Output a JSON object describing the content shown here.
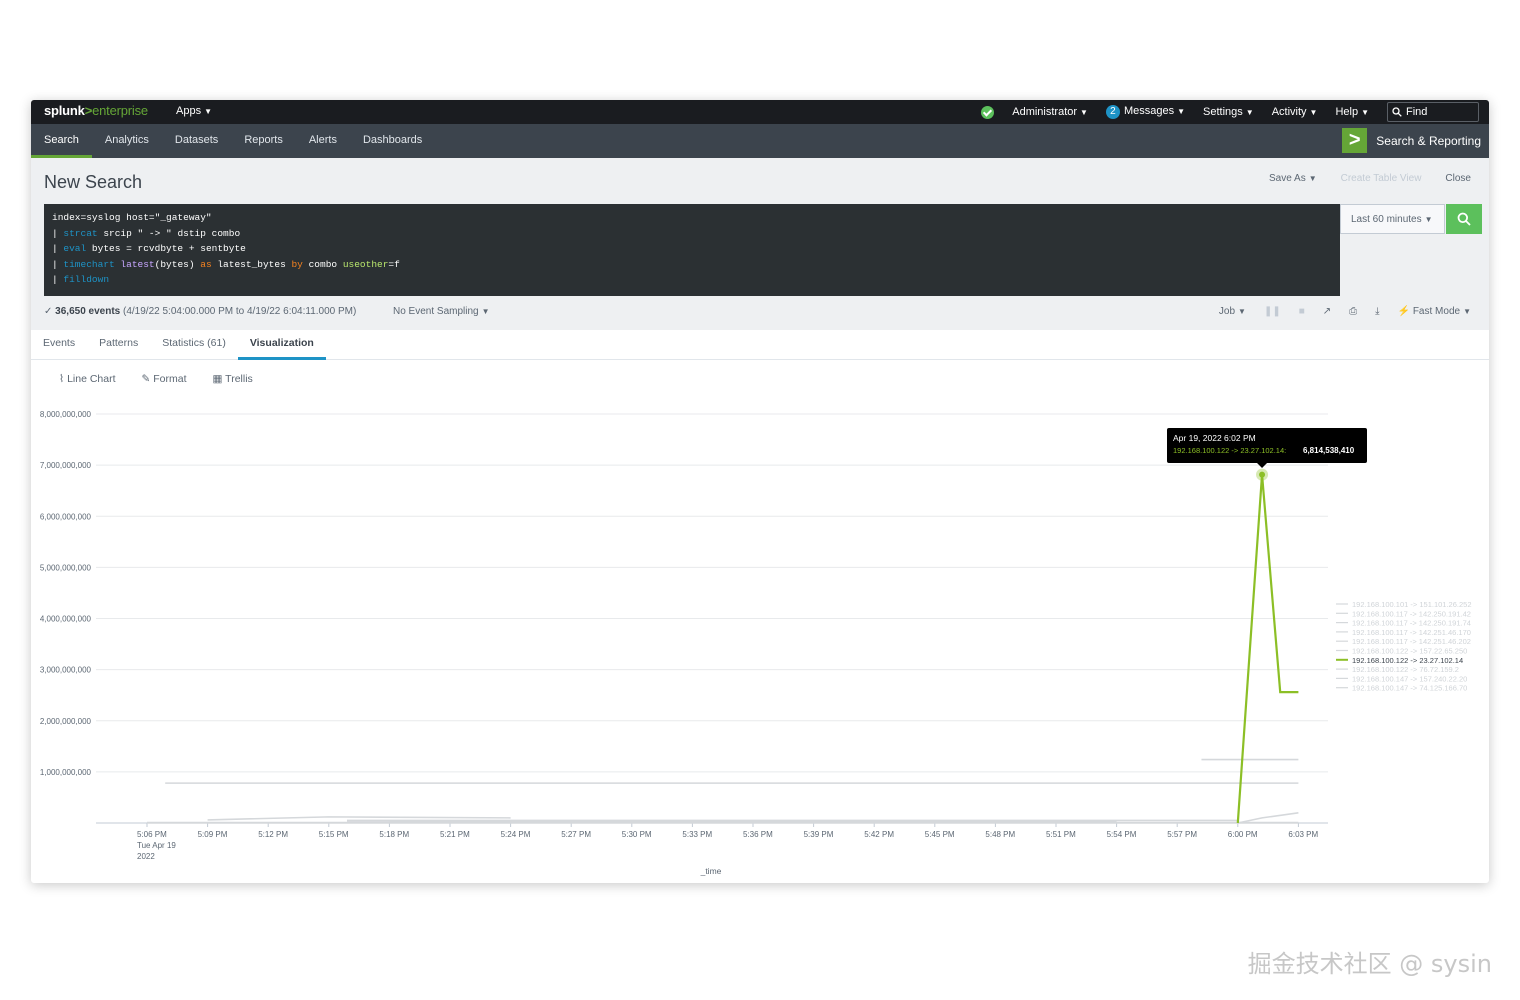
{
  "topbar": {
    "logo_splunk": "splunk",
    "logo_gt": ">",
    "logo_enterprise": "enterprise",
    "apps": "Apps",
    "admin": "Administrator",
    "messages_count": "2",
    "messages": "Messages",
    "settings": "Settings",
    "activity": "Activity",
    "help": "Help",
    "find": "Find"
  },
  "nav": {
    "tabs": [
      "Search",
      "Analytics",
      "Datasets",
      "Reports",
      "Alerts",
      "Dashboards"
    ],
    "app_title": "Search & Reporting"
  },
  "page": {
    "title": "New Search",
    "save_as": "Save As",
    "create_table_view": "Create Table View",
    "close": "Close"
  },
  "query": {
    "line1": "index=syslog host=\"_gateway\"",
    "l2_pipe": "| ",
    "l2_cmd": "strcat",
    "l2_rest": " srcip \" -> \" dstip combo",
    "l3_pipe": "| ",
    "l3_cmd": "eval",
    "l3_rest": " bytes = rcvdbyte + sentbyte",
    "l4_pipe": "| ",
    "l4_cmd": "timechart",
    "l4_fn": "latest",
    "l4_a": "(bytes) ",
    "l4_as": "as",
    "l4_b": " latest_bytes ",
    "l4_by": "by",
    "l4_c": " combo ",
    "l4_arg": "useother",
    "l4_d": "=f",
    "l5_pipe": "| ",
    "l5_cmd": "filldown"
  },
  "time_picker": "Last 60 minutes",
  "status": {
    "check": "✓",
    "events": "36,650 events",
    "range": "(4/19/22 5:04:00.000 PM to 4/19/22 6:04:11.000 PM)",
    "sampling": "No Event Sampling",
    "job": "Job",
    "mode": "Fast Mode"
  },
  "tabs": [
    "Events",
    "Patterns",
    "Statistics (61)",
    "Visualization"
  ],
  "viz": {
    "line_chart": "Line Chart",
    "format": "Format",
    "trellis": "Trellis"
  },
  "chart_data": {
    "type": "line",
    "x": [
      "5:06 PM",
      "5:09 PM",
      "5:12 PM",
      "5:15 PM",
      "5:18 PM",
      "5:21 PM",
      "5:24 PM",
      "5:27 PM",
      "5:30 PM",
      "5:33 PM",
      "5:36 PM",
      "5:39 PM",
      "5:42 PM",
      "5:45 PM",
      "5:48 PM",
      "5:51 PM",
      "5:54 PM",
      "5:57 PM",
      "6:00 PM",
      "6:03 PM"
    ],
    "x_first_sub": [
      "Tue Apr 19",
      "2022"
    ],
    "xlabel": "_time",
    "ylim": [
      0,
      8000000000
    ],
    "yticks": [
      "8,000,000,000",
      "7,000,000,000",
      "6,000,000,000",
      "5,000,000,000",
      "4,000,000,000",
      "3,000,000,000",
      "2,000,000,000",
      "1,000,000,000"
    ],
    "ytick_values": [
      8000000000,
      7000000000,
      6000000000,
      5000000000,
      4000000000,
      3000000000,
      2000000000,
      1000000000
    ],
    "series": [
      {
        "name": "192.168.100.101 -> 151.101.26.252",
        "color": "#d5d8db",
        "points": [
          [
            1.0,
            60000000
          ],
          [
            3.0,
            120000000
          ],
          [
            6.0,
            100000000
          ]
        ]
      },
      {
        "name": "192.168.100.117 -> 142.250.191.42",
        "color": "#d5d8db",
        "points": [
          [
            0.0,
            0
          ],
          [
            19.0,
            0
          ]
        ]
      },
      {
        "name": "192.168.100.117 -> 142.250.191.74",
        "color": "#d5d8db",
        "points": [
          [
            3.3,
            20000000
          ],
          [
            14.4,
            20000000
          ]
        ]
      },
      {
        "name": "192.168.100.117 -> 142.251.46.170",
        "color": "#d5d8db",
        "points": [
          [
            0.3,
            780000000
          ],
          [
            19.0,
            780000000
          ]
        ]
      },
      {
        "name": "192.168.100.117 -> 142.251.46.202",
        "color": "#d5d8db",
        "points": [
          [
            3.3,
            50000000
          ],
          [
            18.0,
            50000000
          ]
        ]
      },
      {
        "name": "192.168.100.122 -> 157.22.65.250",
        "color": "#d5d8db",
        "points": [
          [
            18.0,
            0
          ],
          [
            18.4,
            100000000
          ],
          [
            19.0,
            200000000
          ]
        ]
      },
      {
        "name": "192.168.100.122 -> 23.27.102.14",
        "color": "#8cbf26",
        "points": [
          [
            18.0,
            0
          ],
          [
            18.4,
            6814538410
          ],
          [
            18.7,
            2560000000
          ],
          [
            19.0,
            2560000000
          ]
        ]
      },
      {
        "name": "192.168.100.122 -> 76.72.159.2",
        "color": "#d5d8db",
        "points": [
          [
            17.4,
            1240000000
          ],
          [
            19.0,
            1240000000
          ]
        ]
      },
      {
        "name": "192.168.100.147 -> 157.240.22.20",
        "color": "#d5d8db",
        "points": [
          [
            0.0,
            10000000
          ],
          [
            19.0,
            10000000
          ]
        ]
      },
      {
        "name": "192.168.100.147 -> 74.125.166.70",
        "color": "#d5d8db",
        "points": [
          [
            4.0,
            30000000
          ],
          [
            16.0,
            30000000
          ]
        ]
      }
    ],
    "highlight_series": 6,
    "tooltip": {
      "title": "Apr 19, 2022 6:02 PM",
      "series": "192.168.100.122 -> 23.27.102.14:",
      "value": "6,814,538,410",
      "x": 18.4,
      "y": 6814538410
    },
    "legend_position": "right"
  },
  "watermark": "掘金技术社区 @ sysin"
}
